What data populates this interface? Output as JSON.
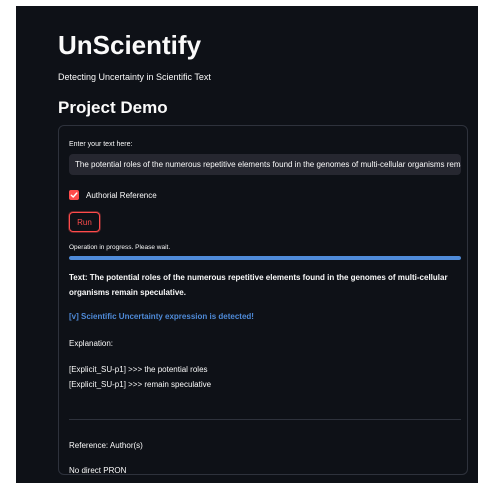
{
  "app": {
    "title": "UnScientify",
    "subtitle": "Detecting Uncertainty in Scientific Text",
    "section_title": "Project Demo"
  },
  "form": {
    "input_label": "Enter your text here:",
    "input_value": "The potential roles of the numerous repetitive elements found in the genomes of multi-cellular organisms remain speculative.",
    "checkbox_label": "Authorial Reference",
    "checkbox_checked": true,
    "run_label": "Run"
  },
  "progress": {
    "text": "Operation in progress. Please wait.",
    "percent": 100
  },
  "results": {
    "text": "Text: The potential roles of the numerous repetitive elements found in the genomes of multi-cellular organisms remain speculative.",
    "detection": "[v] Scientific Uncertainty expression is detected!",
    "explanation_heading": "Explanation:",
    "explanations": [
      "[Explicit_SU-p1] >>> the potential roles",
      "[Explicit_SU-p1] >>> remain speculative"
    ],
    "reference": "Reference: Author(s)",
    "pron": "No direct PRON"
  },
  "colors": {
    "background": "#0e1117",
    "accent": "#ff4b4b",
    "progress": "#4f8bd9",
    "detection": "#4f8bd9",
    "input_bg": "#262730"
  },
  "icons": {
    "checkbox": "check-icon"
  }
}
